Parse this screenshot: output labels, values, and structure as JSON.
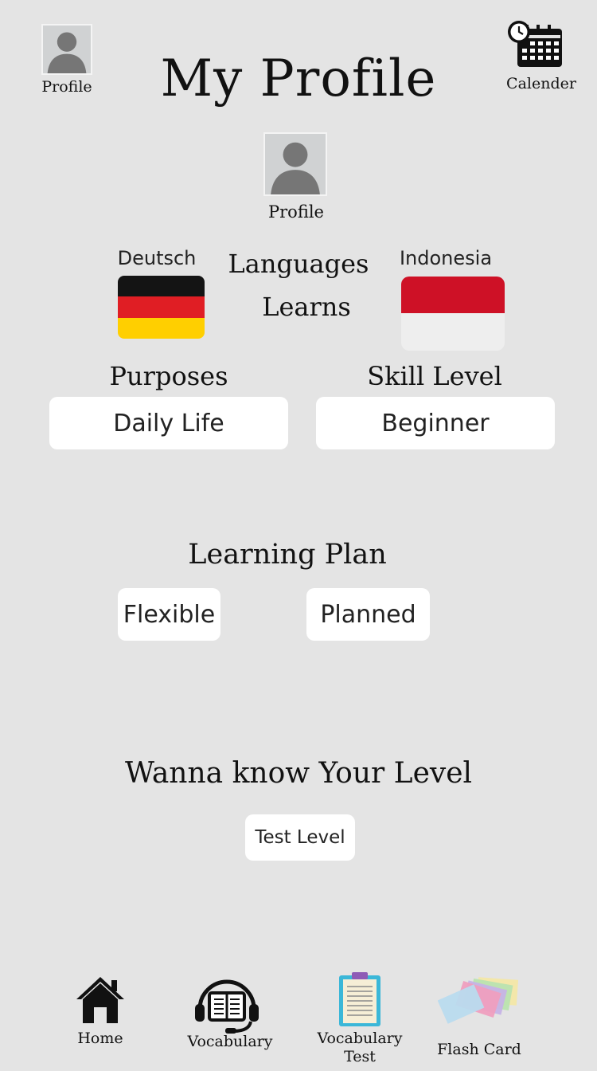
{
  "header": {
    "title": "My Profile",
    "profile_label": "Profile",
    "calendar_label": "Calender"
  },
  "profile": {
    "label": "Profile"
  },
  "languages": {
    "native": {
      "name": "Deutsch",
      "flag": "germany-flag"
    },
    "heading_line1": "Languages",
    "heading_line2": "Learns",
    "learning": {
      "name": "Indonesia",
      "flag": "indonesia-flag"
    }
  },
  "purposes": {
    "label": "Purposes",
    "value": "Daily Life"
  },
  "skill_level": {
    "label": "Skill Level",
    "value": "Beginner"
  },
  "learning_plan": {
    "label": "Learning Plan",
    "options": [
      "Flexible",
      "Planned"
    ]
  },
  "level_test": {
    "prompt": "Wanna know Your Level",
    "button": "Test Level"
  },
  "bottom_nav": [
    {
      "label": "Home",
      "icon": "home-icon"
    },
    {
      "label": "Vocabulary",
      "icon": "headset-book-icon"
    },
    {
      "label": "Vocabulary Test",
      "icon": "clipboard-icon"
    },
    {
      "label": "Flash Card",
      "icon": "flash-cards-icon"
    }
  ],
  "colors": {
    "background": "#e4e4e4",
    "card": "#ffffff",
    "germany": [
      "#141414",
      "#e01e24",
      "#ffcf00"
    ],
    "indonesia": [
      "#ce1126",
      "#eeeeee"
    ]
  }
}
